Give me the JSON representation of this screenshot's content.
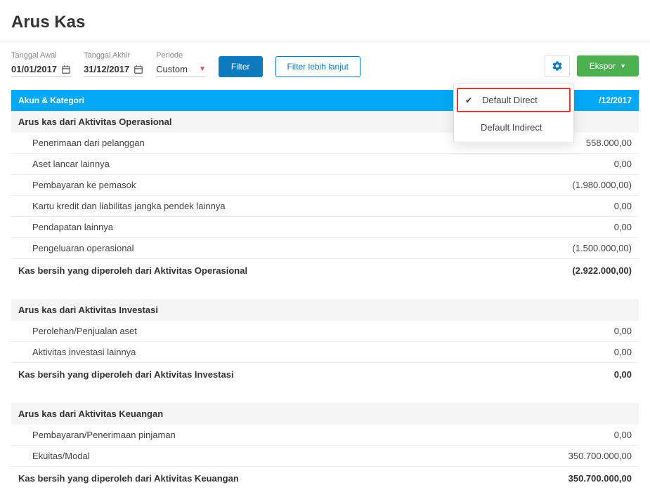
{
  "header": {
    "title": "Arus Kas"
  },
  "toolbar": {
    "start_date_label": "Tanggal Awal",
    "start_date_value": "01/01/2017",
    "end_date_label": "Tanggal Akhir",
    "end_date_value": "31/12/2017",
    "period_label": "Periode",
    "period_value": "Custom",
    "filter_label": "Filter",
    "advanced_filter_label": "Filter lebih lanjut",
    "export_label": "Ekspor"
  },
  "settings_menu": {
    "items": [
      {
        "label": "Default Direct",
        "selected": true
      },
      {
        "label": "Default Indirect",
        "selected": false
      }
    ]
  },
  "table": {
    "columns": [
      "Akun & Kategori",
      "/12/2017"
    ],
    "sections": [
      {
        "title": "Arus kas dari Aktivitas Operasional",
        "rows": [
          {
            "label": "Penerimaan dari pelanggan",
            "value": "558.000,00"
          },
          {
            "label": "Aset lancar lainnya",
            "value": "0,00"
          },
          {
            "label": "Pembayaran ke pemasok",
            "value": "(1.980.000,00)"
          },
          {
            "label": "Kartu kredit dan liabilitas jangka pendek lainnya",
            "value": "0,00"
          },
          {
            "label": "Pendapatan lainnya",
            "value": "0,00"
          },
          {
            "label": "Pengeluaran operasional",
            "value": "(1.500.000,00)"
          }
        ],
        "subtotal": {
          "label": "Kas bersih yang diperoleh dari Aktivitas Operasional",
          "value": "(2.922.000,00)"
        }
      },
      {
        "title": "Arus kas dari Aktivitas Investasi",
        "rows": [
          {
            "label": "Perolehan/Penjualan aset",
            "value": "0,00"
          },
          {
            "label": "Aktivitas investasi lainnya",
            "value": "0,00"
          }
        ],
        "subtotal": {
          "label": "Kas bersih yang diperoleh dari Aktivitas Investasi",
          "value": "0,00"
        }
      },
      {
        "title": "Arus kas dari Aktivitas Keuangan",
        "rows": [
          {
            "label": "Pembayaran/Penerimaan pinjaman",
            "value": "0,00"
          },
          {
            "label": "Ekuitas/Modal",
            "value": "350.700.000,00"
          }
        ],
        "subtotal": {
          "label": "Kas bersih yang diperoleh dari Aktivitas Keuangan",
          "value": "350.700.000,00"
        }
      }
    ]
  }
}
